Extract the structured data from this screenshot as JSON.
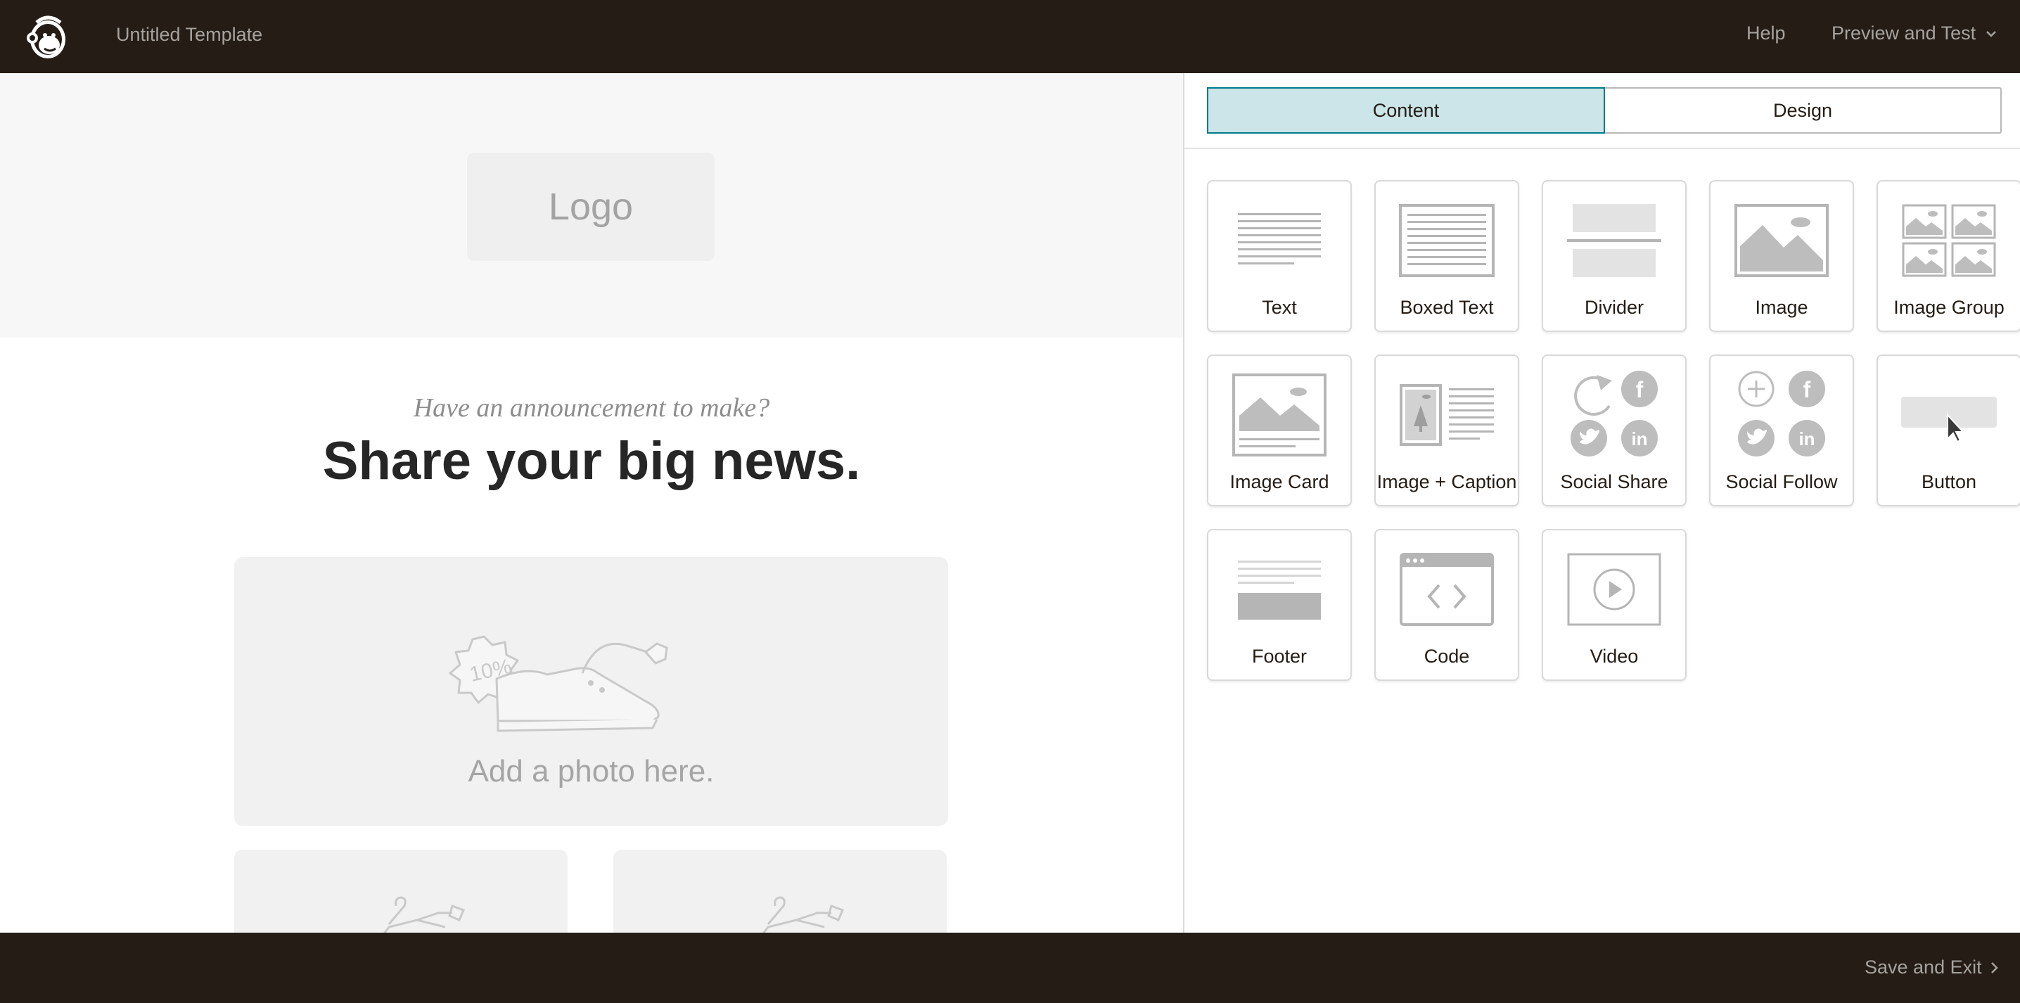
{
  "topbar": {
    "template_title": "Untitled Template",
    "help_label": "Help",
    "preview_label": "Preview and Test"
  },
  "canvas": {
    "logo_placeholder": "Logo",
    "subhead": "Have an announcement to make?",
    "headline": "Share your big news.",
    "photo_placeholder": "Add a photo here."
  },
  "panel": {
    "tabs": [
      {
        "label": "Content",
        "active": true
      },
      {
        "label": "Design",
        "active": false
      }
    ],
    "blocks": [
      {
        "label": "Text",
        "icon": "text-block-icon"
      },
      {
        "label": "Boxed Text",
        "icon": "boxed-text-block-icon"
      },
      {
        "label": "Divider",
        "icon": "divider-block-icon"
      },
      {
        "label": "Image",
        "icon": "image-block-icon"
      },
      {
        "label": "Image Group",
        "icon": "image-group-block-icon"
      },
      {
        "label": "Image Card",
        "icon": "image-card-block-icon"
      },
      {
        "label": "Image + Caption",
        "icon": "image-caption-block-icon"
      },
      {
        "label": "Social Share",
        "icon": "social-share-block-icon"
      },
      {
        "label": "Social Follow",
        "icon": "social-follow-block-icon"
      },
      {
        "label": "Button",
        "icon": "button-block-icon"
      },
      {
        "label": "Footer",
        "icon": "footer-block-icon"
      },
      {
        "label": "Code",
        "icon": "code-block-icon"
      },
      {
        "label": "Video",
        "icon": "video-block-icon"
      }
    ]
  },
  "bottombar": {
    "save_exit_label": "Save and Exit"
  },
  "colors": {
    "bar_bg": "#241c15",
    "accent_teal": "#007c89",
    "active_tab_bg": "#cbe5e8",
    "icon_gray": "#b0b0b0"
  }
}
